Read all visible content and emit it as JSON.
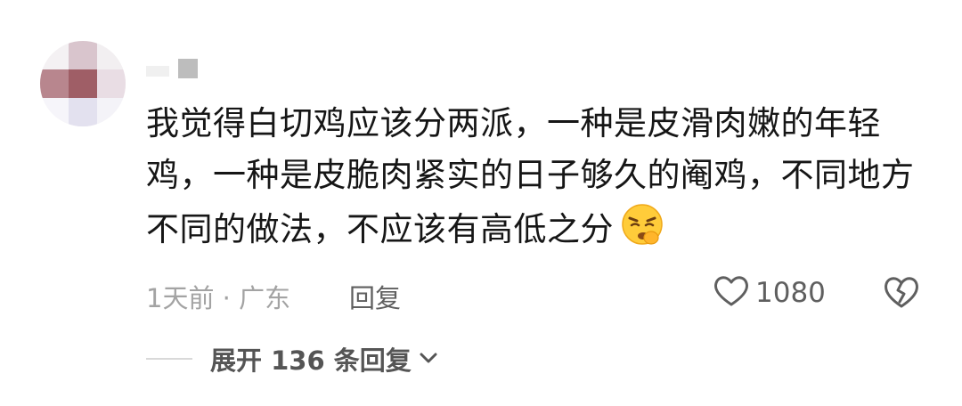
{
  "comment": {
    "text": "我觉得白切鸡应该分两派，一种是皮滑肉嫩的年轻鸡，一种是皮脆肉紧实的日子够久的阉鸡，不同地方不同的做法，不应该有高低之分",
    "emoji": "confounded-face-emoji"
  },
  "meta": {
    "time_location": "1天前 · 广东",
    "reply_label": "回复",
    "like_count": "1080"
  },
  "expand": {
    "label": "展开 136 条回复"
  },
  "icons": {
    "like": "heart-outline-icon",
    "dislike": "broken-heart-icon",
    "expand": "chevron-down-icon"
  },
  "colors": {
    "text_primary": "#161616",
    "text_secondary": "#a3a3a3",
    "text_action": "#5f5f5f"
  }
}
